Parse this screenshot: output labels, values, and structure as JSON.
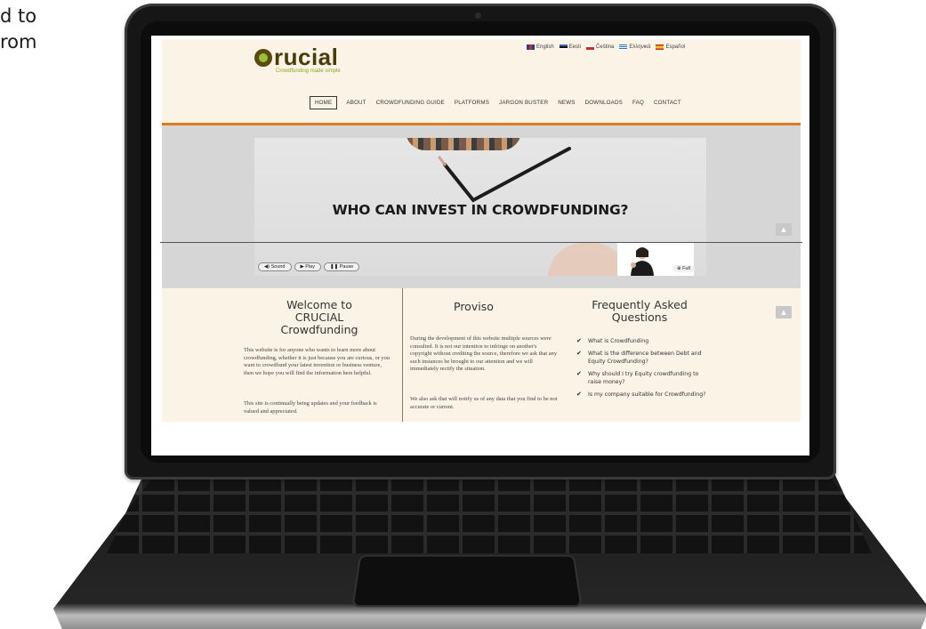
{
  "side_text": {
    "line1": "d to",
    "line2": "rom"
  },
  "site": {
    "logo": {
      "name": "Crucial",
      "tagline": "Crowdfunding made simple"
    },
    "languages": [
      {
        "label": "English",
        "colors": [
          "#1f3f8f",
          "#d12a2a"
        ]
      },
      {
        "label": "Eesti",
        "colors": [
          "#2d6cc0",
          "#111111"
        ]
      },
      {
        "label": "Čeština",
        "colors": [
          "#ffffff",
          "#d12a2a",
          "#1f3f8f"
        ]
      },
      {
        "label": "Ελληνικά",
        "colors": [
          "#2d6cc0",
          "#ffffff"
        ]
      },
      {
        "label": "Español",
        "colors": [
          "#c62828",
          "#f3c31a"
        ]
      }
    ],
    "nav": [
      "HOME",
      "ABOUT",
      "CROWDFUNDING GUIDE",
      "PLATFORMS",
      "JARGON BUSTER",
      "NEWS",
      "DOWNLOADS",
      "FAQ",
      "CONTACT"
    ],
    "video": {
      "title": "WHO CAN INVEST IN CROWDFUNDING?",
      "controls": [
        "◀) Sound",
        "▶ Play",
        "❚❚ Pause"
      ],
      "full_label": "⊕ Full"
    },
    "welcome": {
      "heading": "Welcome to CRUCIAL Crowdfunding",
      "p1": "This website is for anyone who wants to learn more about crowdfunding, whether it is just because you are curious, or you want to crowdfund your latest invention or business venture, then we hope you will find the information here helpful.",
      "p2": "This site is continually being updates and your feedback is valued and appreciated."
    },
    "proviso": {
      "heading": "Proviso",
      "p1": "During the development of this website multiple sources were consulted. It is not our intention to infringe on another's copyright without crediting the source, therefore we ask that any such instances be brought to our attention and we will immediately rectify the situation.",
      "p2": "We also ask that will notify us of any data that you find to be not accurate or current."
    },
    "faq": {
      "heading": "Frequently Asked Questions",
      "items": [
        "What is Crowdfunding",
        "What is the difference between Debt and Equity Crowdfunding?",
        "Why should I try Equity crowdfunding to raise money?",
        "Is my company suitable for Crowdfunding?"
      ]
    },
    "colors": {
      "accent_orange": "#e07a22",
      "cream": "#fbf3e6",
      "logo_green": "#9bbf3b",
      "logo_brown": "#4a3b0a"
    }
  }
}
